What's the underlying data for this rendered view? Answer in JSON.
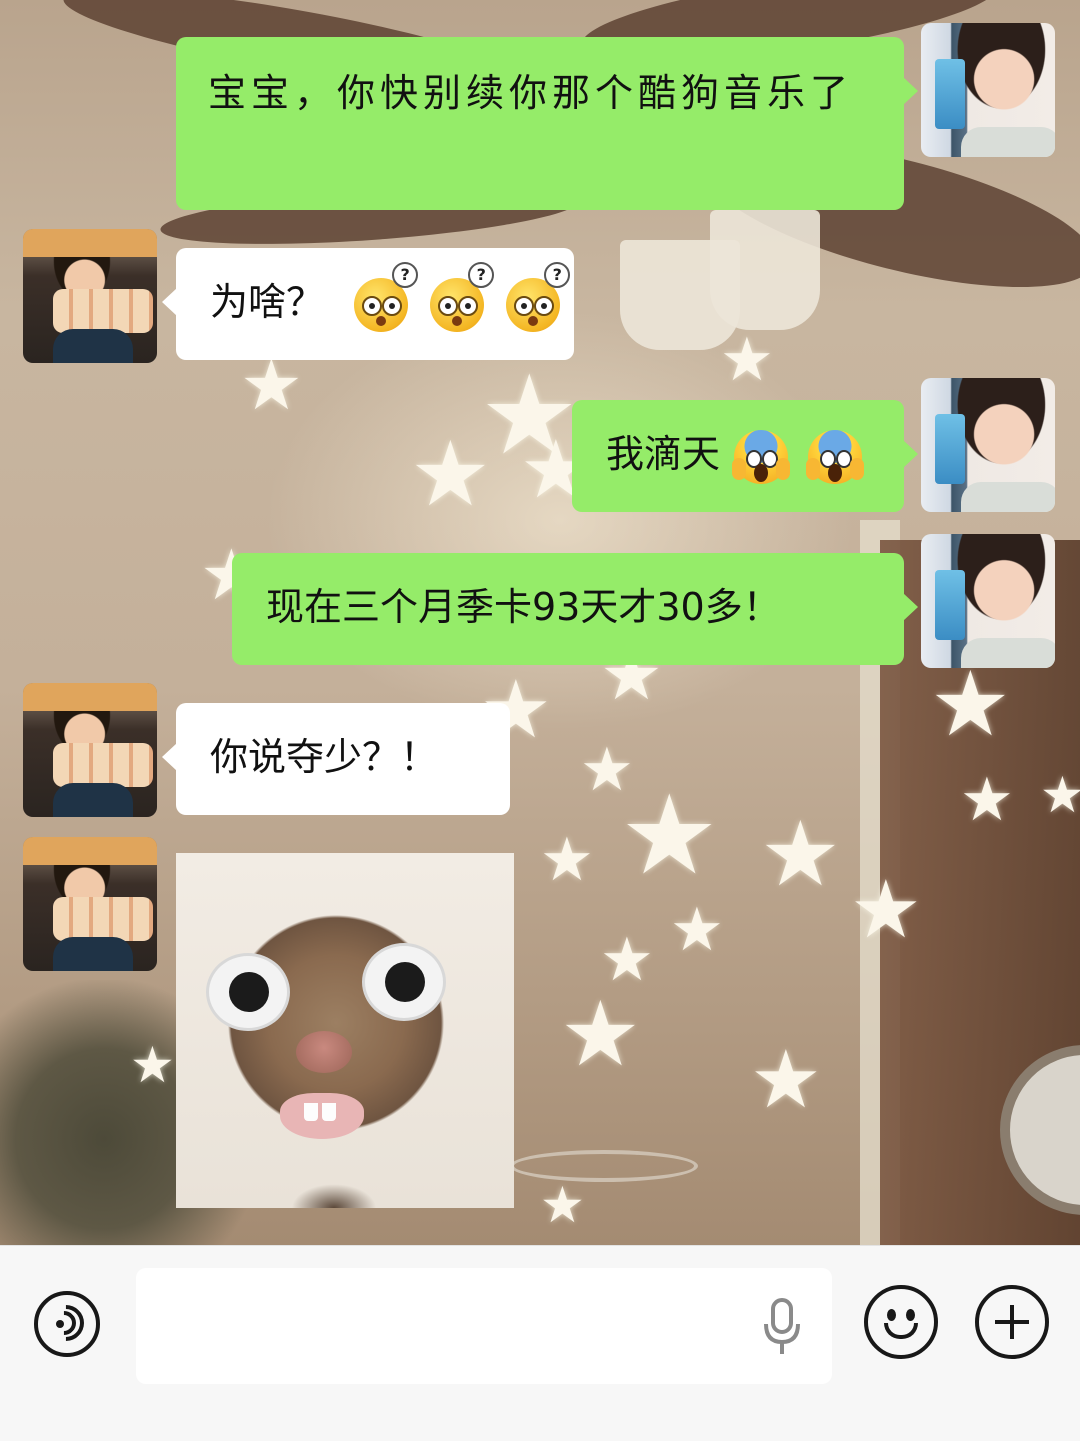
{
  "messages": [
    {
      "sender": "me",
      "type": "text",
      "text": "宝宝，你快别续你那个酷狗音乐了"
    },
    {
      "sender": "her",
      "type": "text",
      "text": "为啥？",
      "emojis": [
        "confused-face-emoji",
        "confused-face-emoji",
        "confused-face-emoji"
      ]
    },
    {
      "sender": "me",
      "type": "text",
      "text": "我滴天",
      "emojis": [
        "screaming-face-emoji",
        "screaming-face-emoji"
      ]
    },
    {
      "sender": "me",
      "type": "text",
      "text": "现在三个月季卡93天才30多！"
    },
    {
      "sender": "her",
      "type": "text",
      "text": "你说夺少？！"
    },
    {
      "sender": "her",
      "type": "sticker",
      "sticker": "surprised-cat-sticker"
    }
  ],
  "input_bar": {
    "placeholder": "",
    "icons": [
      "voice-icon",
      "microphone-icon",
      "emoji-icon",
      "plus-icon"
    ]
  },
  "colors": {
    "sent_bubble": "#95ec69",
    "received_bubble": "#ffffff",
    "input_bar_bg": "#f7f7f7"
  }
}
